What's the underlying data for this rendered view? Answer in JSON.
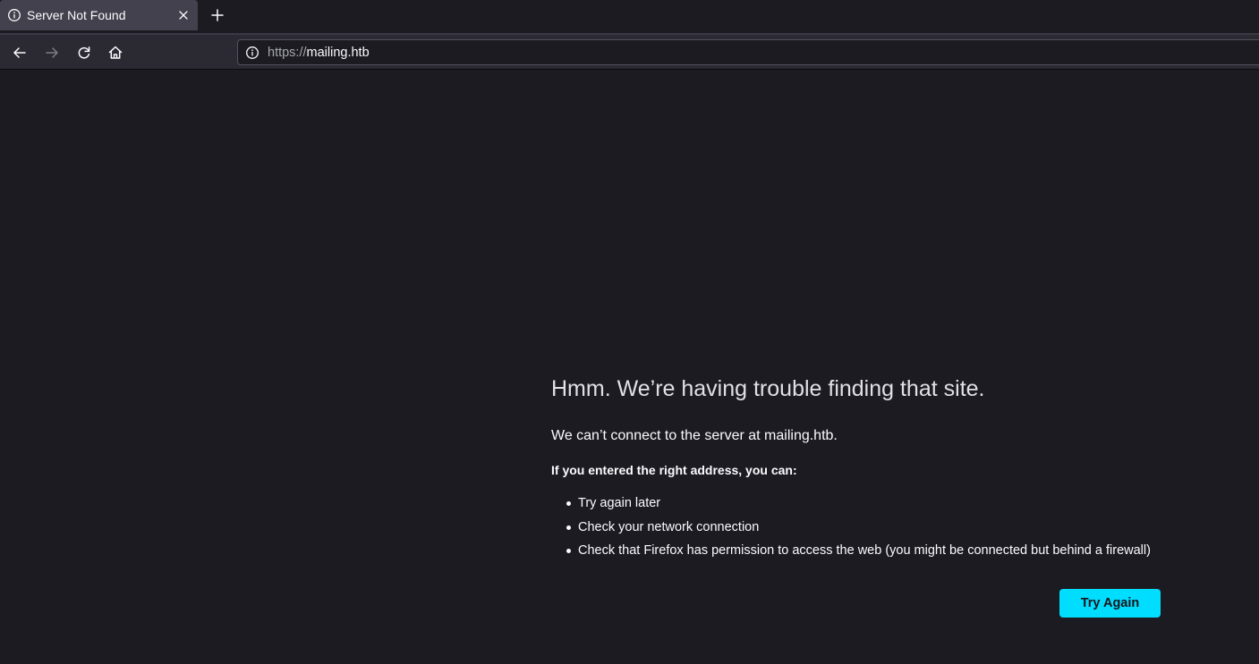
{
  "browser": {
    "tab": {
      "title": "Server Not Found",
      "icon": "info-icon"
    },
    "toolbar": {
      "back_icon": "arrow-left-icon",
      "forward_icon": "arrow-right-icon",
      "reload_icon": "reload-icon",
      "home_icon": "home-icon"
    },
    "urlbar": {
      "scheme": "https://",
      "host": "mailing.htb",
      "icon": "info-icon"
    }
  },
  "error_page": {
    "title": "Hmm. We’re having trouble finding that site.",
    "description": "We can’t connect to the server at mailing.htb.",
    "subheading": "If you entered the right address, you can:",
    "suggestions": [
      "Try again later",
      "Check your network connection",
      "Check that Firefox has permission to access the web (you might be connected but behind a firewall)"
    ],
    "button_label": "Try Again"
  },
  "colors": {
    "page_background": "#1c1b22",
    "toolbar_background": "#2b2a33",
    "tab_selected": "#42414d",
    "accent_button": "#00ddff",
    "text": "#fbfbfe"
  }
}
